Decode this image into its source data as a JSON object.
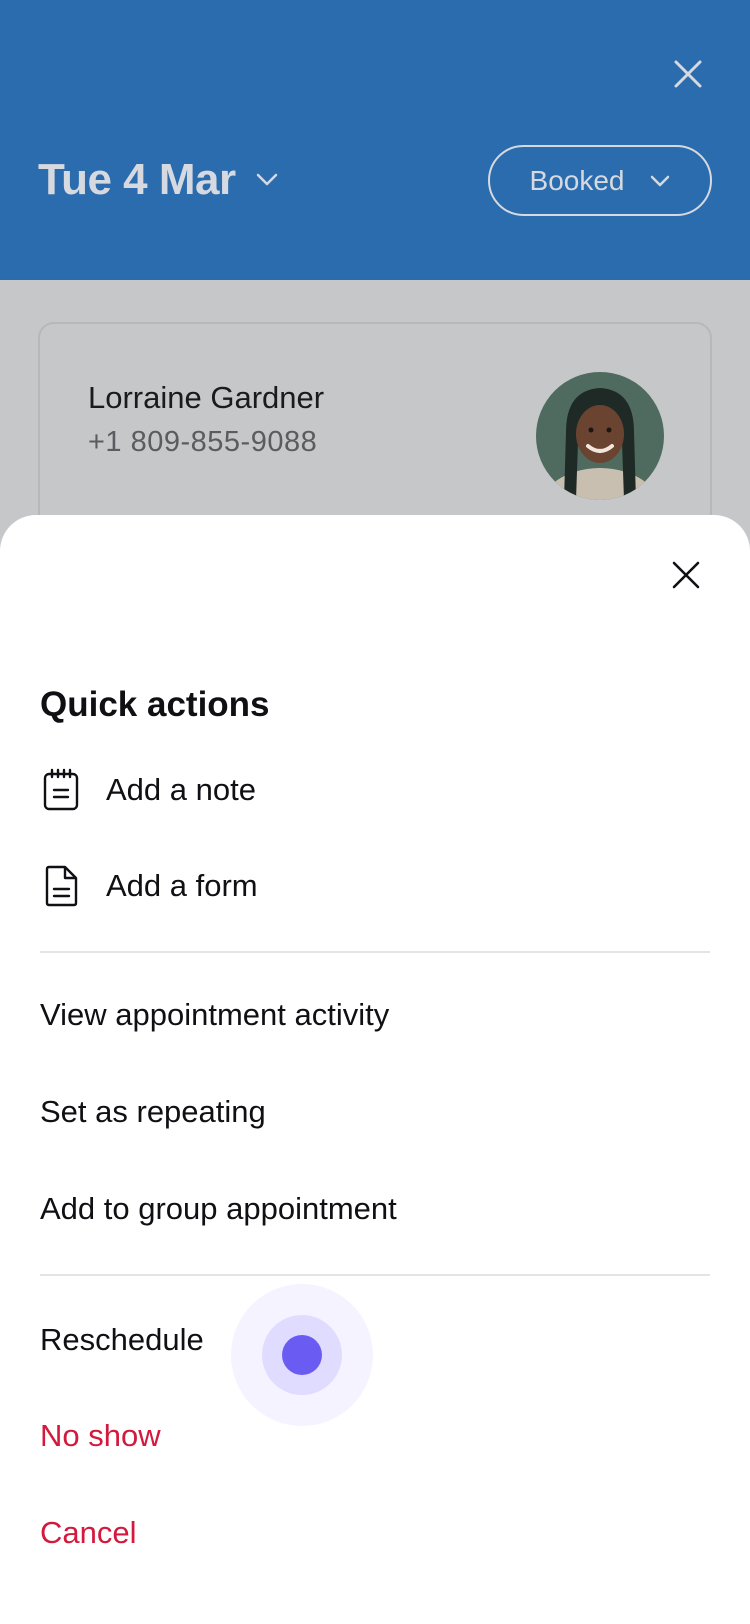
{
  "header": {
    "date": "Tue 4 Mar",
    "status": "Booked"
  },
  "client": {
    "name": "Lorraine Gardner",
    "phone": "+1 809-855-9088"
  },
  "sheet": {
    "title": "Quick actions",
    "quick_actions": [
      {
        "label": "Add a note",
        "icon": "notepad-icon"
      },
      {
        "label": "Add a form",
        "icon": "document-icon"
      }
    ],
    "actions": [
      {
        "label": "View appointment activity"
      },
      {
        "label": "Set as repeating"
      },
      {
        "label": "Add to group appointment"
      }
    ],
    "status_actions": [
      {
        "label": "Reschedule"
      },
      {
        "label": "No show"
      },
      {
        "label": "Cancel"
      }
    ]
  },
  "colors": {
    "header_bg": "#2a6cae",
    "overlay_bg": "#c6c7c9",
    "danger": "#d3193d",
    "touch_dot": "#6a5cf2"
  }
}
